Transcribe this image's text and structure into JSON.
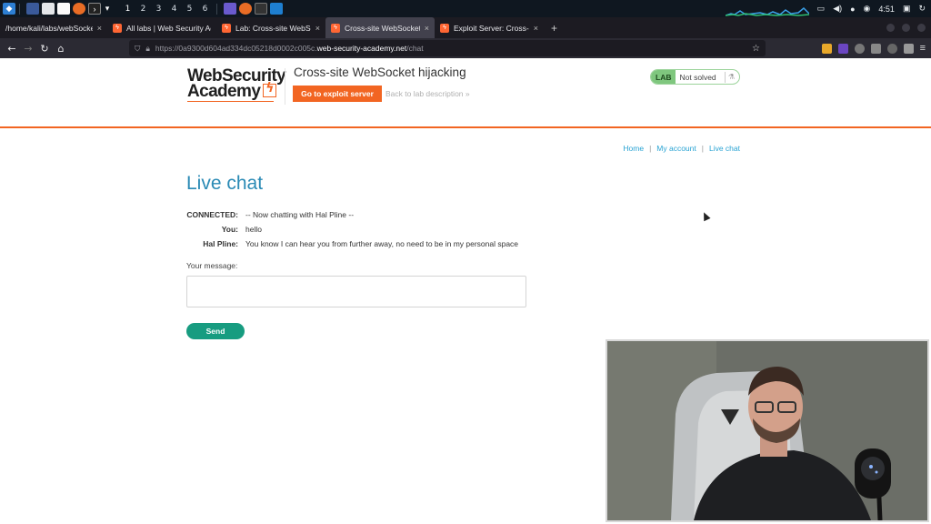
{
  "taskbar": {
    "workspaces": [
      "1",
      "2",
      "3",
      "4",
      "5",
      "6"
    ],
    "clock": "4:51"
  },
  "tabs": [
    {
      "title": "/home/kali/labs/webSockets",
      "active": false
    },
    {
      "title": "All labs | Web Security Ac",
      "active": false
    },
    {
      "title": "Lab: Cross-site WebSocke",
      "active": false
    },
    {
      "title": "Cross-site WebSocket hij",
      "active": true
    },
    {
      "title": "Exploit Server: Cross-site",
      "active": false
    }
  ],
  "address_bar": {
    "prefix": "https://0a9300d604ad334dc05218d0002c005c.",
    "domain": "web-security-academy.net",
    "path": "/chat"
  },
  "header": {
    "logo_line1": "WebSecurity",
    "logo_line2": "Academy",
    "lab_title": "Cross-site WebSocket hijacking",
    "exploit_button": "Go to exploit server",
    "back_link": "Back to lab description",
    "lab_badge": "LAB",
    "lab_status": "Not solved"
  },
  "nav": {
    "home": "Home",
    "account": "My account",
    "live_chat": "Live chat",
    "separator": "|"
  },
  "main": {
    "heading": "Live chat",
    "messages": [
      {
        "who": "CONNECTED:",
        "text": "-- Now chatting with Hal Pline --"
      },
      {
        "who": "You:",
        "text": "hello"
      },
      {
        "who": "Hal Pline:",
        "text": "You know I can hear you from further away, no need to be in my personal space"
      }
    ],
    "message_label": "Your message:",
    "send_button": "Send"
  },
  "colors": {
    "accent": "#f26522",
    "link": "#29a3d3",
    "heading": "#2a8ab5",
    "send": "#179c80",
    "badge": "#7fc77e"
  }
}
